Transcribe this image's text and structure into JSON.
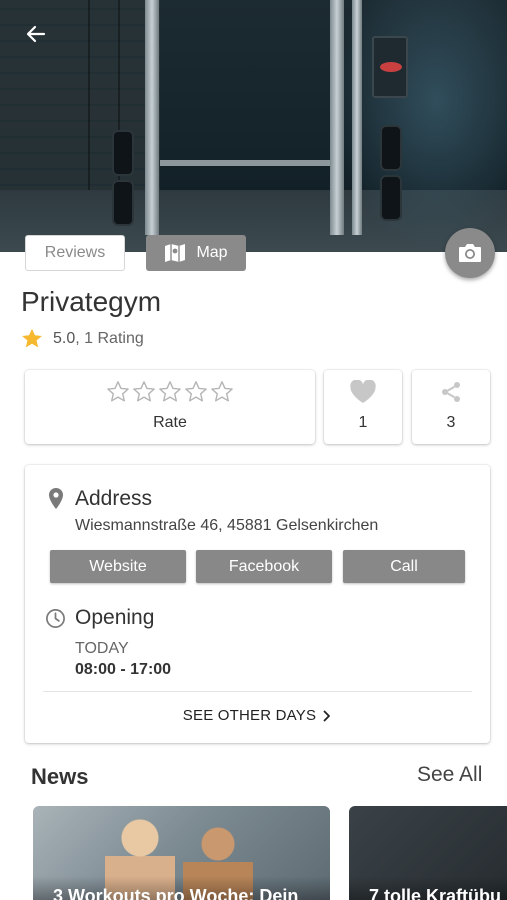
{
  "hero": {
    "image_alt": "gym-equipment-photo"
  },
  "tabs": {
    "reviews": "Reviews",
    "map": "Map"
  },
  "place": {
    "name": "Privategym",
    "rating_score": "5.0",
    "rating_count": ", 1 Rating"
  },
  "actions": {
    "rate_label": "Rate",
    "likes": "1",
    "shares": "3"
  },
  "address": {
    "heading": "Address",
    "text": "Wiesmannstraße 46, 45881  Gelsenkirchen",
    "buttons": {
      "website": "Website",
      "facebook": "Facebook",
      "call": "Call"
    }
  },
  "opening": {
    "heading": "Opening",
    "day": "TODAY",
    "hours": "08:00 - 17:00",
    "see_other_days": "SEE OTHER DAYS"
  },
  "news": {
    "title": "News",
    "see_all": "See All",
    "items": [
      {
        "caption": "3 Workouts pro Woche: Dein"
      },
      {
        "caption": "7 tolle Kraftübu"
      }
    ]
  },
  "colors": {
    "accent_gray": "#888888",
    "star_yellow": "#f5b82e"
  },
  "icons": [
    "back-arrow-icon",
    "camera-icon",
    "map-icon",
    "star-icon",
    "heart-icon",
    "share-icon",
    "location-pin-icon",
    "clock-icon",
    "chevron-right-icon"
  ]
}
